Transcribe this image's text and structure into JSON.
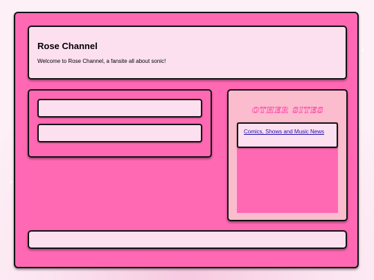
{
  "header": {
    "title": "Rose Channel",
    "description": "Welcome to Rose Channel, a fansite all about sonic!"
  },
  "sidebar": {
    "heading": "OTHER SITES",
    "links": [
      {
        "label": "Comics, Shows and Music News"
      }
    ]
  },
  "colors": {
    "frame": "#ff69b4",
    "panel": "#fde0f0",
    "sidebar": "#fbbccd",
    "link": "#1a0dab"
  }
}
